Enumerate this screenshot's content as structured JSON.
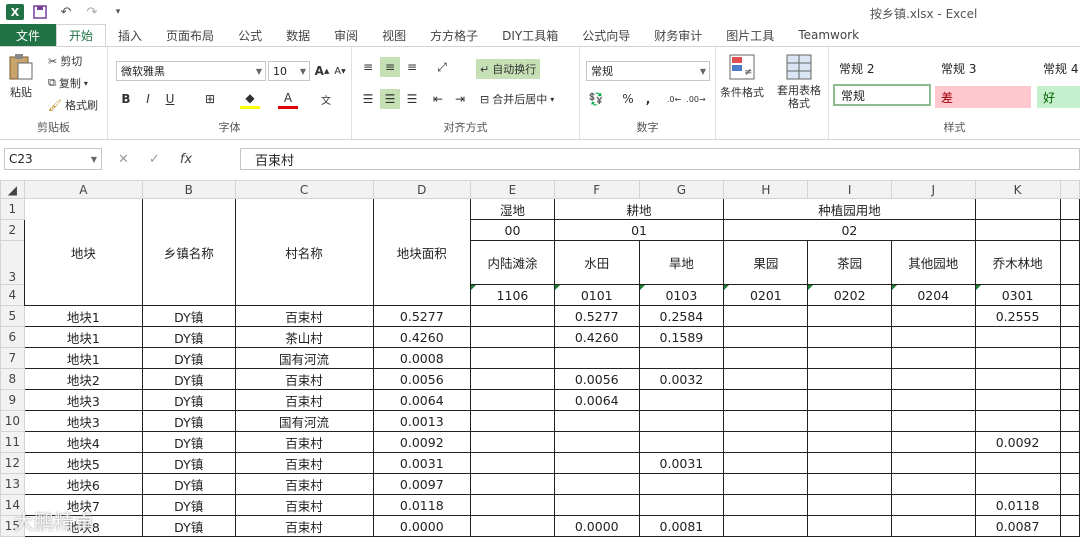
{
  "app": {
    "title": "按乡镇.xlsx - Excel",
    "logo": "X"
  },
  "quick_access": [
    "save-icon",
    "undo-icon",
    "redo-icon",
    "customize-icon"
  ],
  "tabs": [
    {
      "label": "文件",
      "type": "file"
    },
    {
      "label": "开始",
      "active": true
    },
    {
      "label": "插入"
    },
    {
      "label": "页面布局"
    },
    {
      "label": "公式"
    },
    {
      "label": "数据"
    },
    {
      "label": "审阅"
    },
    {
      "label": "视图"
    },
    {
      "label": "方方格子"
    },
    {
      "label": "DIY工具箱"
    },
    {
      "label": "公式向导"
    },
    {
      "label": "财务审计"
    },
    {
      "label": "图片工具"
    },
    {
      "label": "Teamwork"
    }
  ],
  "ribbon": {
    "clipboard": {
      "paste": "粘贴",
      "cut": "剪切",
      "copy": "复制",
      "format_painter": "格式刷",
      "label": "剪贴板"
    },
    "font": {
      "name": "微软雅黑",
      "size": "10",
      "label": "字体",
      "bold": "B",
      "italic": "I",
      "underline": "U"
    },
    "alignment": {
      "wrap": "自动换行",
      "merge": "合并后居中",
      "label": "对齐方式"
    },
    "number": {
      "format": "常规",
      "label": "数字",
      "percent": "%",
      "comma": ","
    },
    "styles_btns": {
      "conditional": "条件格式",
      "table": "套用表格格式"
    },
    "styles": {
      "label": "样式",
      "cells": [
        {
          "label": "常规 2"
        },
        {
          "label": "常规 3"
        },
        {
          "label": "常规 4"
        },
        {
          "label": "常规"
        },
        {
          "label": "差"
        },
        {
          "label": "好"
        }
      ]
    }
  },
  "formula_bar": {
    "name_box": "C23",
    "value": "百束村",
    "fx": "fx"
  },
  "columns": [
    "A",
    "B",
    "C",
    "D",
    "E",
    "F",
    "G",
    "H",
    "I",
    "J",
    "K"
  ],
  "header": {
    "r1": {
      "E": "湿地",
      "FG": "耕地",
      "HJ": "种植园用地"
    },
    "r2": {
      "E": "00",
      "FG": "01",
      "HJ": "02"
    },
    "r3": {
      "A": "地块",
      "B": "乡镇名称",
      "C": "村名称",
      "D": "地块面积",
      "E": "内陆滩涂",
      "F": "水田",
      "G": "旱地",
      "H": "果园",
      "I": "茶园",
      "J": "其他园地",
      "K": "乔木林地"
    },
    "r4": {
      "E": "1106",
      "F": "0101",
      "G": "0103",
      "H": "0201",
      "I": "0202",
      "J": "0204",
      "K": "0301"
    }
  },
  "rows": [
    {
      "n": "5",
      "A": "地块1",
      "B": "DY镇",
      "C": "百束村",
      "D": "0.5277",
      "E": "",
      "F": "0.5277",
      "G": "0.2584",
      "H": "",
      "I": "",
      "J": "",
      "K": "0.2555"
    },
    {
      "n": "6",
      "A": "地块1",
      "B": "DY镇",
      "C": "茶山村",
      "D": "0.4260",
      "E": "",
      "F": "0.4260",
      "G": "0.1589",
      "H": "",
      "I": "",
      "J": "",
      "K": ""
    },
    {
      "n": "7",
      "A": "地块1",
      "B": "DY镇",
      "C": "国有河流",
      "D": "0.0008",
      "E": "",
      "F": "",
      "G": "",
      "H": "",
      "I": "",
      "J": "",
      "K": ""
    },
    {
      "n": "8",
      "A": "地块2",
      "B": "DY镇",
      "C": "百束村",
      "D": "0.0056",
      "E": "",
      "F": "0.0056",
      "G": "0.0032",
      "H": "",
      "I": "",
      "J": "",
      "K": ""
    },
    {
      "n": "9",
      "A": "地块3",
      "B": "DY镇",
      "C": "百束村",
      "D": "0.0064",
      "E": "",
      "F": "0.0064",
      "G": "",
      "H": "",
      "I": "",
      "J": "",
      "K": ""
    },
    {
      "n": "10",
      "A": "地块3",
      "B": "DY镇",
      "C": "国有河流",
      "D": "0.0013",
      "E": "",
      "F": "",
      "G": "",
      "H": "",
      "I": "",
      "J": "",
      "K": ""
    },
    {
      "n": "11",
      "A": "地块4",
      "B": "DY镇",
      "C": "百束村",
      "D": "0.0092",
      "E": "",
      "F": "",
      "G": "",
      "H": "",
      "I": "",
      "J": "",
      "K": "0.0092"
    },
    {
      "n": "12",
      "A": "地块5",
      "B": "DY镇",
      "C": "百束村",
      "D": "0.0031",
      "E": "",
      "F": "",
      "G": "0.0031",
      "H": "",
      "I": "",
      "J": "",
      "K": ""
    },
    {
      "n": "13",
      "A": "地块6",
      "B": "DY镇",
      "C": "百束村",
      "D": "0.0097",
      "E": "",
      "F": "",
      "G": "",
      "H": "",
      "I": "",
      "J": "",
      "K": ""
    },
    {
      "n": "14",
      "A": "地块7",
      "B": "DY镇",
      "C": "百束村",
      "D": "0.0118",
      "E": "",
      "F": "",
      "G": "",
      "H": "",
      "I": "",
      "J": "",
      "K": "0.0118"
    },
    {
      "n": "15",
      "A": "地块8",
      "B": "DY镇",
      "C": "百束村",
      "D": "0.0000",
      "E": "",
      "F": "0.0000",
      "G": "0.0081",
      "H": "",
      "I": "",
      "J": "",
      "K": "0.0087"
    }
  ],
  "watermark": "大鹏精卓",
  "colors": {
    "excel_green": "#217346",
    "bad_bg": "#ffc7ce",
    "good_bg": "#c6efce",
    "bad_fg": "#9c0006",
    "good_fg": "#006100"
  }
}
